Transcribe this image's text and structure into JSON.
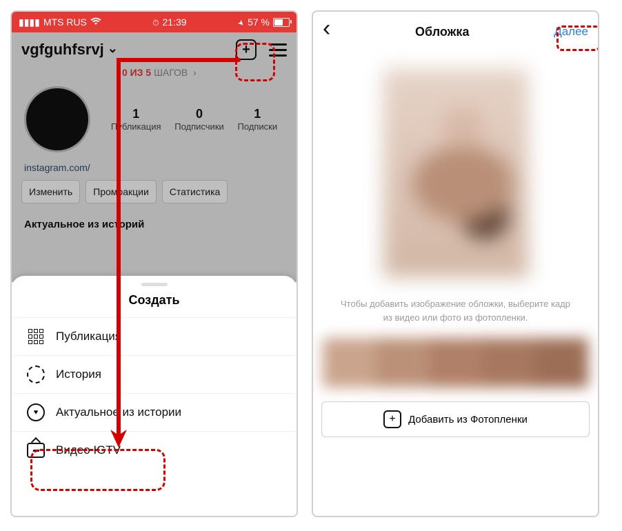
{
  "status": {
    "carrier": "MTS RUS",
    "time": "21:39",
    "battery": "57 %"
  },
  "profile": {
    "username": "vgfguhfsrvj",
    "steps_red": "0 ИЗ 5",
    "steps_gray": "ШАГОВ",
    "stats": {
      "posts_num": "1",
      "posts_lbl": "Публикация",
      "followers_num": "0",
      "followers_lbl": "Подписчики",
      "following_num": "1",
      "following_lbl": "Подписки"
    },
    "bio_link": "instagram.com/",
    "buttons": {
      "edit": "Изменить",
      "promo": "Промоакции",
      "stats": "Статистика"
    },
    "highlights_lbl": "Актуальное из историй"
  },
  "sheet": {
    "title": "Создать",
    "post": "Публикация",
    "story": "История",
    "highlight": "Актуальное из истории",
    "igtv": "Видео IGTV"
  },
  "right": {
    "title": "Обложка",
    "next": "Далее",
    "hint": "Чтобы добавить изображение обложки, выберите кадр из видео или фото из фотопленки.",
    "add_btn": "Добавить из Фотопленки"
  }
}
